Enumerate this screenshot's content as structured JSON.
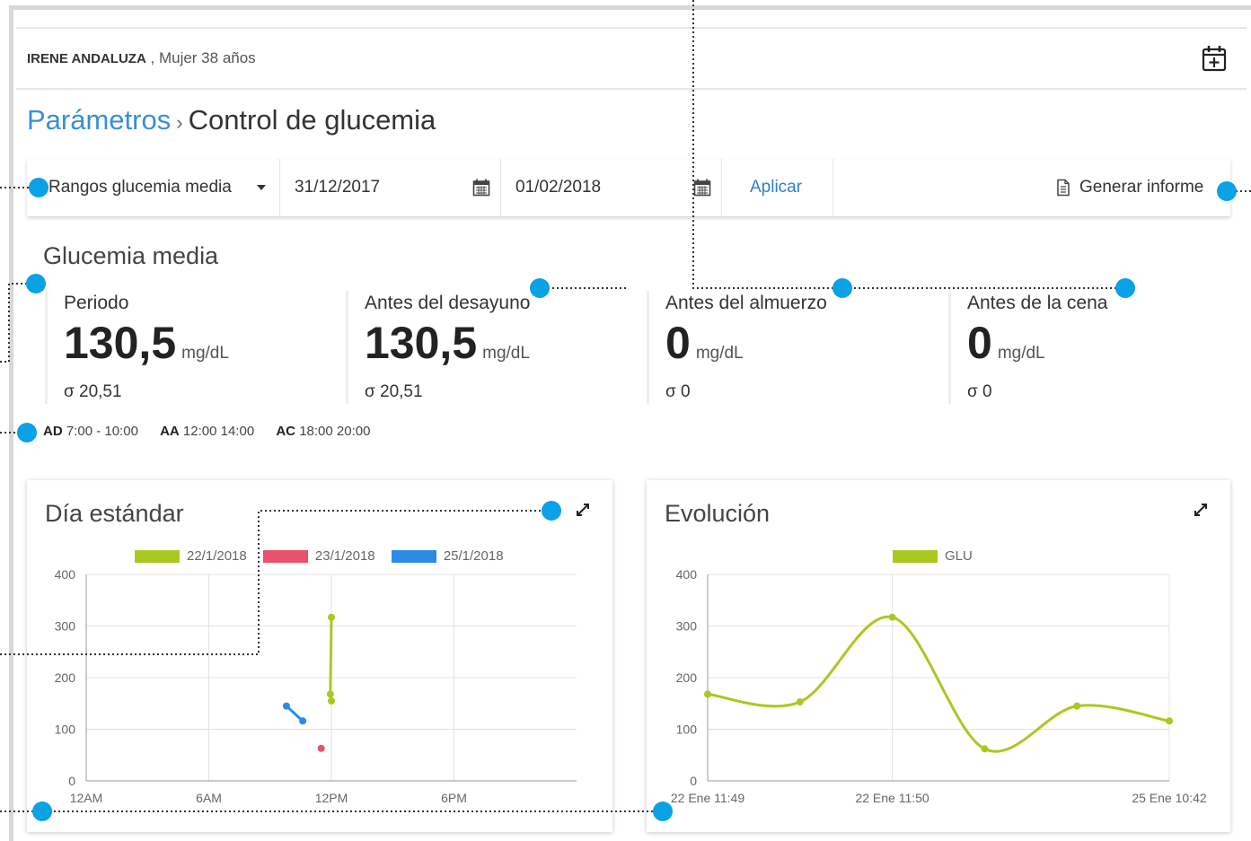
{
  "patient": {
    "name": "IRENE ANDALUZA",
    "separator": " , ",
    "details": "Mujer 38 años",
    "calendar_icon": "calendar-plus-icon"
  },
  "breadcrumb": {
    "parent": "Parámetros",
    "separator": "›",
    "current": "Control de glucemia"
  },
  "toolbar": {
    "range_select": "Rangos glucemia media",
    "date_from": "31/12/2017",
    "date_to": "01/02/2018",
    "apply": "Aplicar",
    "report": "Generar informe"
  },
  "section_title": "Glucemia media",
  "stats": [
    {
      "label": "Periodo",
      "value": "130,5",
      "unit": "mg/dL",
      "sigma": "σ 20,51"
    },
    {
      "label": "Antes del desayuno",
      "value": "130,5",
      "unit": "mg/dL",
      "sigma": "σ 20,51"
    },
    {
      "label": "Antes del almuerzo",
      "value": "0",
      "unit": "mg/dL",
      "sigma": "σ 0"
    },
    {
      "label": "Antes de la cena",
      "value": "0",
      "unit": "mg/dL",
      "sigma": "σ 0"
    }
  ],
  "ranges": [
    {
      "code": "AD",
      "time": "7:00 - 10:00"
    },
    {
      "code": "AA",
      "time": "12:00 14:00"
    },
    {
      "code": "AC",
      "time": "18:00 20:00"
    }
  ],
  "colors": {
    "accent": "#3a8fd6",
    "callout": "#0aa1e6",
    "green": "#a8c920",
    "red": "#e8506b",
    "blue": "#2b8be6"
  },
  "chart_data": [
    {
      "type": "line",
      "title": "Día estándar",
      "xlabel": "",
      "ylabel": "",
      "ylim": [
        0,
        400
      ],
      "yticks": [
        "400",
        "300",
        "200",
        "100",
        "0"
      ],
      "xticks": [
        "12AM",
        "6AM",
        "12PM",
        "6PM"
      ],
      "xlim_hours": [
        0,
        24
      ],
      "grid": true,
      "legend": "top",
      "series": [
        {
          "name": "22/1/2018",
          "color": "#a8c920",
          "points": [
            [
              12.0,
              317
            ],
            [
              11.95,
              168
            ],
            [
              12.0,
              155
            ]
          ]
        },
        {
          "name": "23/1/2018",
          "color": "#e8506b",
          "points": [
            [
              11.5,
              63
            ]
          ]
        },
        {
          "name": "25/1/2018",
          "color": "#2b8be6",
          "points": [
            [
              9.8,
              145
            ],
            [
              10.6,
              116
            ]
          ]
        }
      ]
    },
    {
      "type": "line",
      "title": "Evolución",
      "xlabel": "",
      "ylabel": "",
      "ylim": [
        0,
        400
      ],
      "yticks": [
        "400",
        "300",
        "200",
        "100",
        "0"
      ],
      "xticks": [
        "22 Ene 11:49",
        "22 Ene 11:50",
        "25 Ene 10:42"
      ],
      "grid": true,
      "legend": "top",
      "series": [
        {
          "name": "GLU",
          "color": "#a8c920",
          "values": [
            168,
            153,
            317,
            62,
            145,
            116
          ]
        }
      ]
    }
  ]
}
